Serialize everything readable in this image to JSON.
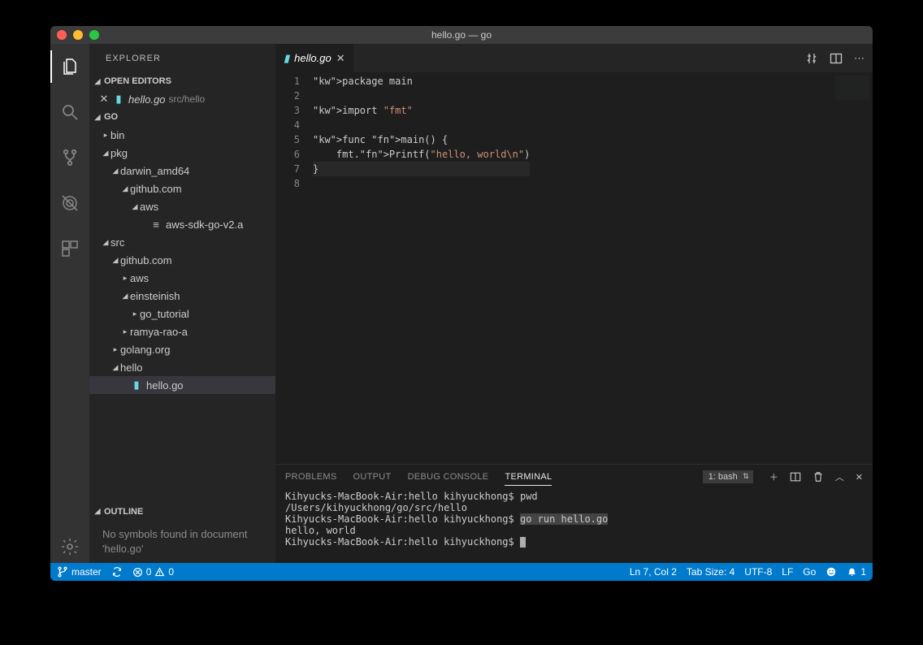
{
  "window": {
    "title": "hello.go — go"
  },
  "sidebar": {
    "title": "EXPLORER",
    "sections": {
      "open_editors": {
        "label": "OPEN EDITORS",
        "items": [
          {
            "name": "hello.go",
            "path": "src/hello"
          }
        ]
      },
      "workspace": {
        "label": "GO",
        "tree": [
          {
            "label": "bin",
            "depth": 0,
            "expanded": false,
            "type": "folder"
          },
          {
            "label": "pkg",
            "depth": 0,
            "expanded": true,
            "type": "folder"
          },
          {
            "label": "darwin_amd64",
            "depth": 1,
            "expanded": true,
            "type": "folder"
          },
          {
            "label": "github.com",
            "depth": 2,
            "expanded": true,
            "type": "folder"
          },
          {
            "label": "aws",
            "depth": 3,
            "expanded": true,
            "type": "folder"
          },
          {
            "label": "aws-sdk-go-v2.a",
            "depth": 4,
            "expanded": false,
            "type": "file"
          },
          {
            "label": "src",
            "depth": 0,
            "expanded": true,
            "type": "folder"
          },
          {
            "label": "github.com",
            "depth": 1,
            "expanded": true,
            "type": "folder"
          },
          {
            "label": "aws",
            "depth": 2,
            "expanded": false,
            "type": "folder"
          },
          {
            "label": "einsteinish",
            "depth": 2,
            "expanded": true,
            "type": "folder"
          },
          {
            "label": "go_tutorial",
            "depth": 3,
            "expanded": false,
            "type": "folder"
          },
          {
            "label": "ramya-rao-a",
            "depth": 2,
            "expanded": false,
            "type": "folder"
          },
          {
            "label": "golang.org",
            "depth": 1,
            "expanded": false,
            "type": "folder"
          },
          {
            "label": "hello",
            "depth": 1,
            "expanded": true,
            "type": "folder"
          },
          {
            "label": "hello.go",
            "depth": 2,
            "expanded": false,
            "type": "gofile",
            "selected": true
          }
        ]
      },
      "outline": {
        "label": "OUTLINE",
        "message": "No symbols found in document 'hello.go'"
      }
    }
  },
  "editor": {
    "tab": {
      "name": "hello.go"
    },
    "lines": [
      "package main",
      "",
      "import \"fmt\"",
      "",
      "func main() {",
      "    fmt.Printf(\"hello, world\\n\")",
      "}",
      ""
    ],
    "line_numbers": [
      "1",
      "2",
      "3",
      "4",
      "5",
      "6",
      "7",
      "8"
    ],
    "current_line": 7
  },
  "panel": {
    "tabs": {
      "problems": "PROBLEMS",
      "output": "OUTPUT",
      "debug": "DEBUG CONSOLE",
      "terminal": "TERMINAL"
    },
    "active": "terminal",
    "terminal_select": "1: bash",
    "terminal_lines": [
      {
        "text": "Kihyucks-MacBook-Air:hello kihyuckhong$ pwd"
      },
      {
        "text": "/Users/kihyuckhong/go/src/hello"
      },
      {
        "prefix": "Kihyucks-MacBook-Air:hello kihyuckhong$ ",
        "cmd": "go run hello.go"
      },
      {
        "text": "hello, world"
      },
      {
        "prefix": "Kihyucks-MacBook-Air:hello kihyuckhong$ ",
        "cursor": true
      }
    ]
  },
  "statusbar": {
    "branch": "master",
    "errors": "0",
    "warnings": "0",
    "position": "Ln 7, Col 2",
    "tabsize": "Tab Size: 4",
    "encoding": "UTF-8",
    "eol": "LF",
    "language": "Go",
    "notifications": "1"
  }
}
